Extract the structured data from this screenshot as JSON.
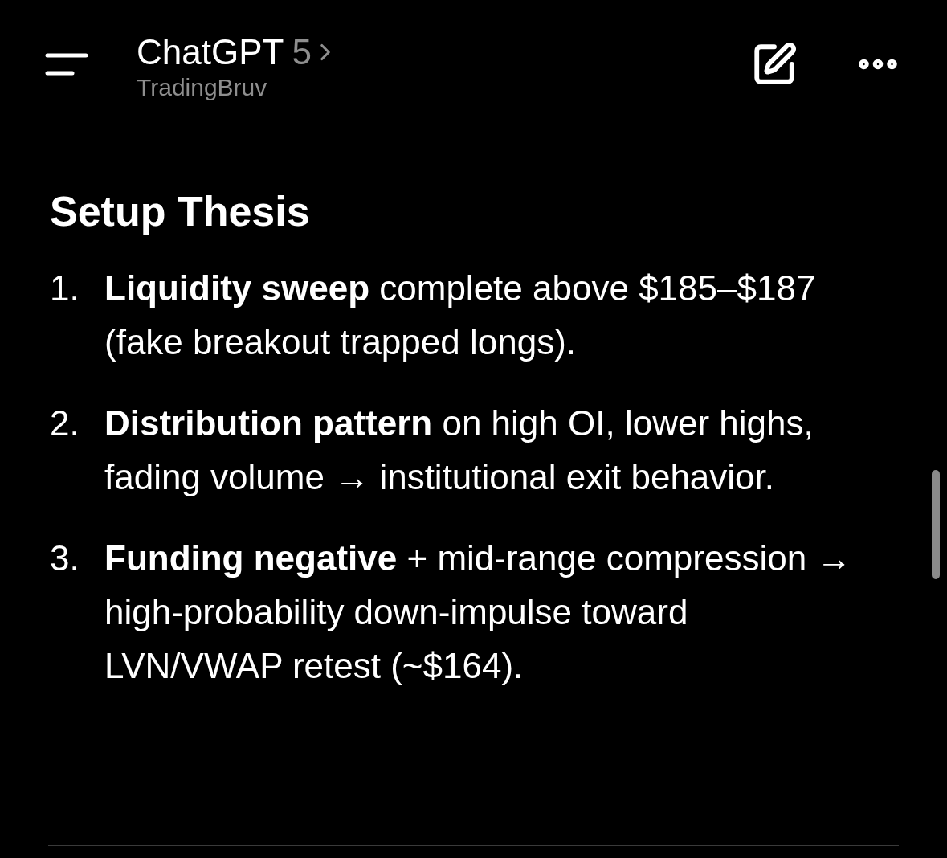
{
  "header": {
    "title": "ChatGPT",
    "model": "5",
    "subtitle": "TradingBruv"
  },
  "section": {
    "heading": "Setup Thesis",
    "items": [
      {
        "number": "1.",
        "text": "**Liquidity sweep** complete above $185–$187 (fake breakout trapped longs)."
      },
      {
        "number": "2.",
        "text": "**Distribution pattern** on high OI, lower highs, fading volume → institutional exit behavior."
      },
      {
        "number": "3.",
        "text": "**Funding negative** + mid-range compression → high-probability down-impulse toward LVN/VWAP retest (~$164)."
      }
    ]
  }
}
